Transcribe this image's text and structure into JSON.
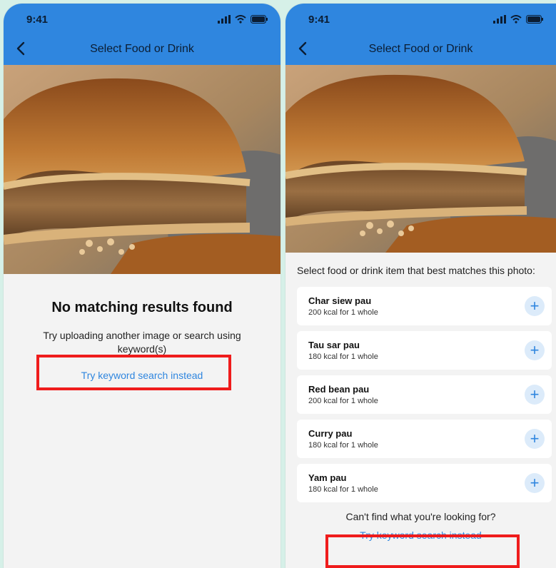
{
  "left": {
    "status": {
      "time": "9:41"
    },
    "header": {
      "title": "Select Food or Drink"
    },
    "no_results": {
      "title": "No matching results found",
      "subtitle": "Try uploading another image or search using keyword(s)",
      "keyword_link": "Try keyword search instead"
    }
  },
  "right": {
    "status": {
      "time": "9:41"
    },
    "header": {
      "title": "Select Food or Drink"
    },
    "prompt": "Select food or drink item that best matches this photo:",
    "items": [
      {
        "name": "Char siew pau",
        "kcal": "200 kcal for 1 whole"
      },
      {
        "name": "Tau sar pau",
        "kcal": "180 kcal for 1 whole"
      },
      {
        "name": "Red bean pau",
        "kcal": "200 kcal for 1 whole"
      },
      {
        "name": "Curry pau",
        "kcal": "180 kcal for 1 whole"
      },
      {
        "name": "Yam pau",
        "kcal": "180 kcal for 1 whole"
      }
    ],
    "add_symbol": "+",
    "cant_find": "Can't find what you're looking for?",
    "keyword_link": "Try keyword search instead"
  },
  "colors": {
    "accent": "#2f86df",
    "highlight": "#ef1c1c",
    "background": "#d6f0e8"
  }
}
